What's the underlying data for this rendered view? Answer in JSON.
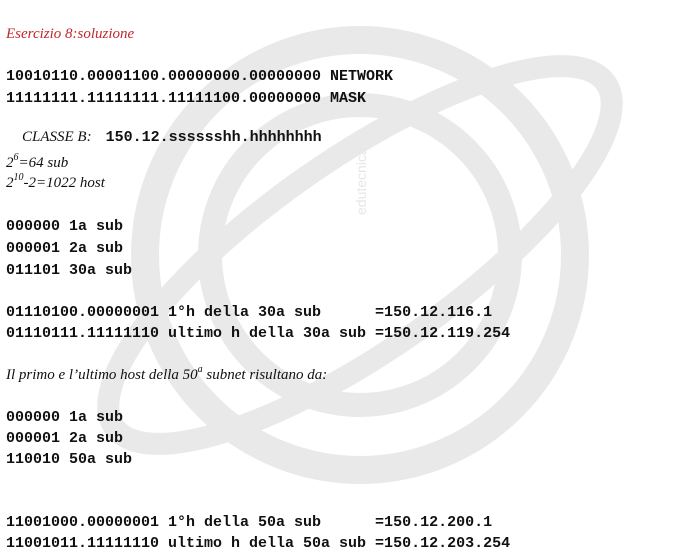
{
  "title": "Esercizio 8:soluzione",
  "network_line": "10010110.00001100.00000000.00000000 NETWORK",
  "mask_line": "11111111.11111111.11111100.00000000 MASK",
  "class_label": "CLASSE B:",
  "class_value": "150.12.sssssshh.hhhhhhhh",
  "subnets_formula": {
    "base": "2",
    "exp": "6",
    "rest": "=64 sub"
  },
  "hosts_formula": {
    "base": "2",
    "exp": "10",
    "rest": "-2=1022 host"
  },
  "sub_list_1": [
    "000000 1a sub",
    "000001 2a sub",
    "011101 30a sub"
  ],
  "host_30": [
    "01110100.00000001 1°h della 30a sub      =150.12.116.1",
    "01110111.11111110 ultimo h della 30a sub =150.12.119.254"
  ],
  "sentence": {
    "before": "Il primo e l’ultimo host della 50",
    "sup": "a",
    "after": " subnet risultano da:"
  },
  "sub_list_2": [
    "000000 1a sub",
    "000001 2a sub",
    "110010 50a sub"
  ],
  "host_50": [
    "11001000.00000001 1°h della 50a sub      =150.12.200.1",
    "11001011.11111110 ultimo h della 50a sub =150.12.203.254"
  ],
  "watermark_text": "edutecnica"
}
